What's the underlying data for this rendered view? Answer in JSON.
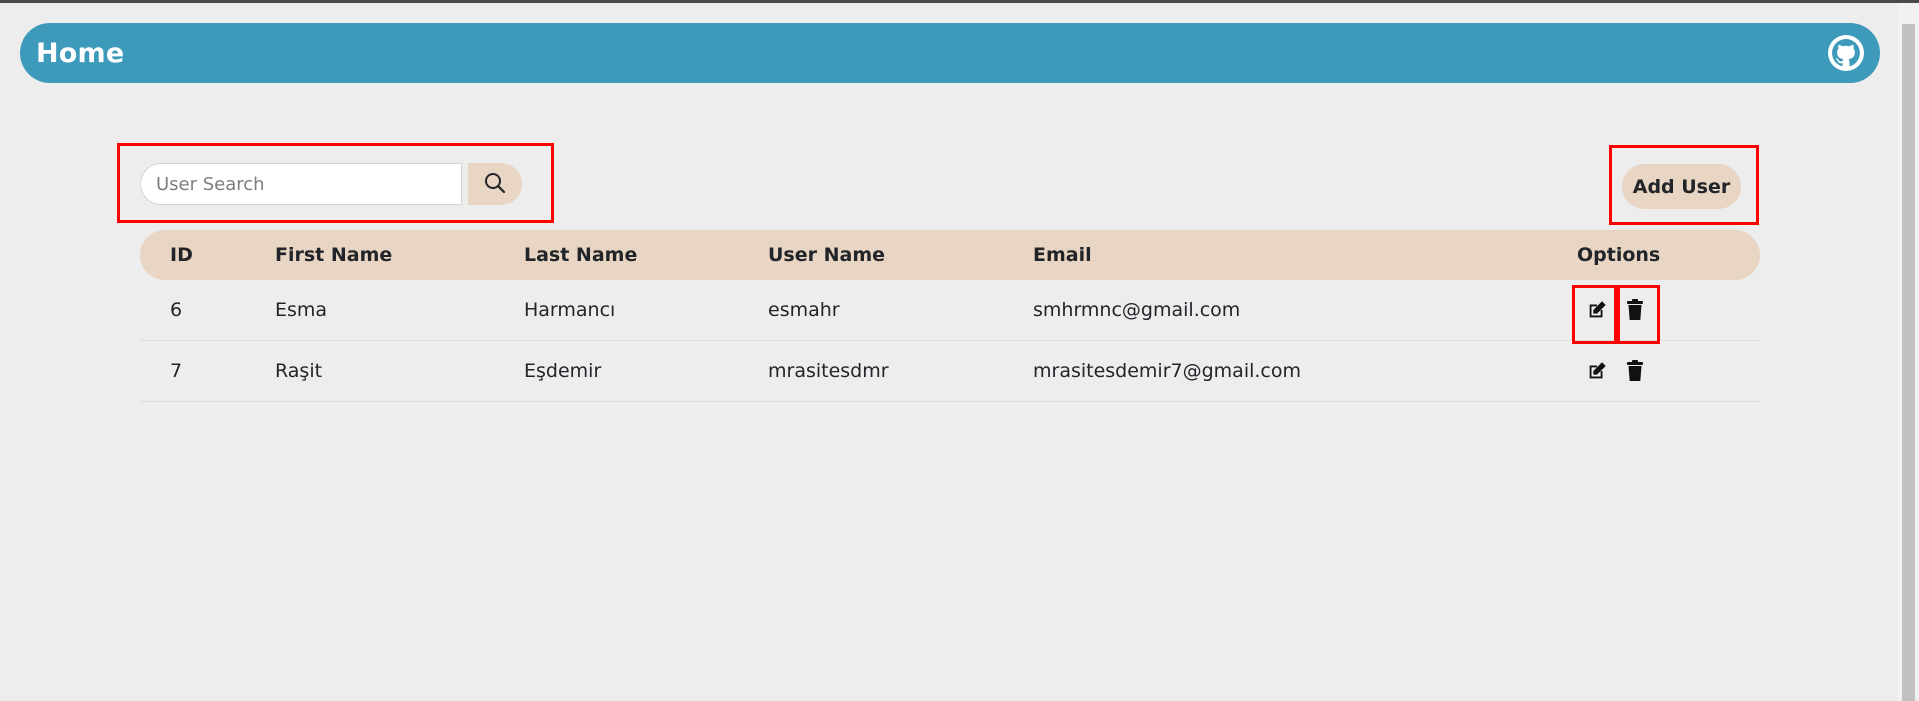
{
  "navbar": {
    "title": "Home",
    "github_icon": "github-icon"
  },
  "search": {
    "placeholder": "User Search",
    "button_icon": "search-icon"
  },
  "actions": {
    "add_user_label": "Add User"
  },
  "table": {
    "headers": {
      "id": "ID",
      "first": "First Name",
      "last": "Last Name",
      "user": "User Name",
      "email": "Email",
      "options": "Options"
    },
    "rows": [
      {
        "id": "6",
        "first": "Esma",
        "last": "Harmancı",
        "user": "esmahr",
        "email": "smhrmnc@gmail.com"
      },
      {
        "id": "7",
        "first": "Raşit",
        "last": "Eşdemir",
        "user": "mrasitesdmr",
        "email": "mrasitesdemir7@gmail.com"
      }
    ],
    "row_action_icons": [
      "edit-icon",
      "trash-icon"
    ]
  },
  "colors": {
    "navbar": "#3d9aba",
    "accent": "#e8d5c3",
    "background": "#ededed",
    "highlight": "#ff0000"
  }
}
